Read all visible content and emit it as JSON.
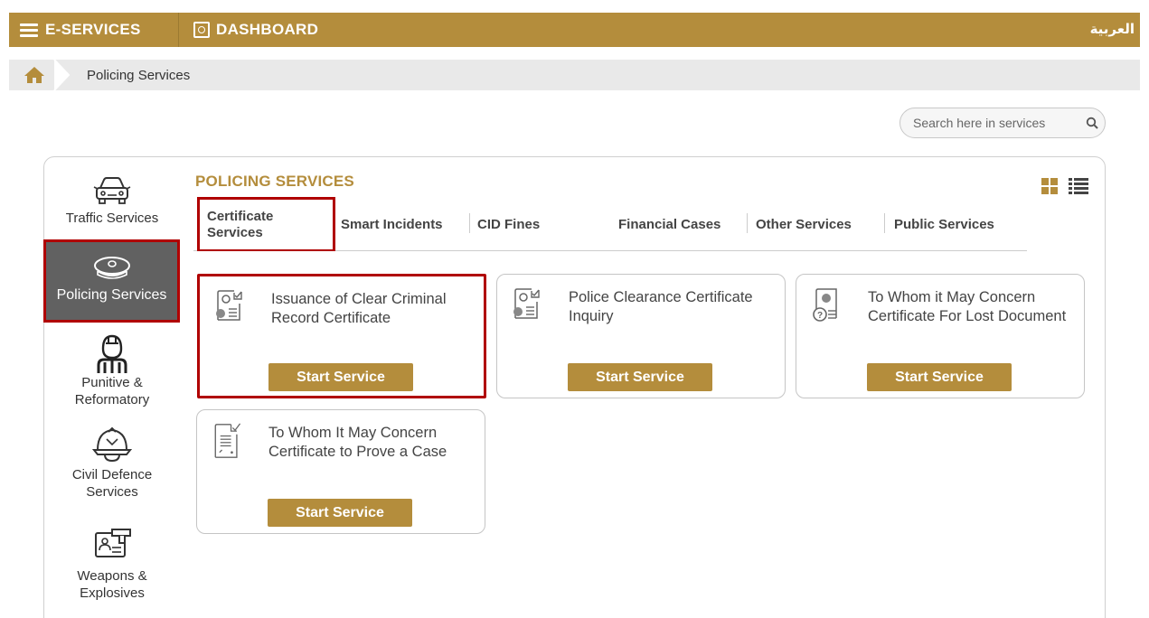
{
  "topbar": {
    "eservices_label": "E-SERVICES",
    "dashboard_label": "DASHBOARD",
    "language_label": "العربية",
    "brand_color": "#b48d3c"
  },
  "breadcrumb": {
    "current": "Policing Services"
  },
  "search": {
    "placeholder": "Search here in services"
  },
  "sidebar": {
    "items": [
      {
        "label": "Traffic Services",
        "icon": "car-icon"
      },
      {
        "label": "Policing Services",
        "icon": "police-cap-icon",
        "active": true
      },
      {
        "label": "Punitive & Reformatory",
        "icon": "prisoner-icon"
      },
      {
        "label": "Civil Defence Services",
        "icon": "firefighter-helmet-icon"
      },
      {
        "label": "Weapons & Explosives",
        "icon": "weapon-license-icon"
      }
    ]
  },
  "main": {
    "title": "POLICING SERVICES",
    "tabs": [
      {
        "label": "Certificate Services",
        "active": true
      },
      {
        "label": "Smart Incidents"
      },
      {
        "label": "CID Fines"
      },
      {
        "label": "Financial Cases"
      },
      {
        "label": "Other Services"
      },
      {
        "label": "Public Services"
      }
    ],
    "cards": [
      {
        "title": "Issuance of Clear Criminal Record Certificate",
        "button": "Start Service",
        "icon": "fingerprint-certificate-icon"
      },
      {
        "title": "Police Clearance Certificate Inquiry",
        "button": "Start Service",
        "icon": "fingerprint-certificate-icon"
      },
      {
        "title": "To Whom it May Concern Certificate For Lost Document",
        "button": "Start Service",
        "icon": "lost-document-certificate-icon"
      },
      {
        "title": "To Whom It May Concern Certificate to Prove a Case",
        "button": "Start Service",
        "icon": "signed-document-icon"
      }
    ]
  }
}
